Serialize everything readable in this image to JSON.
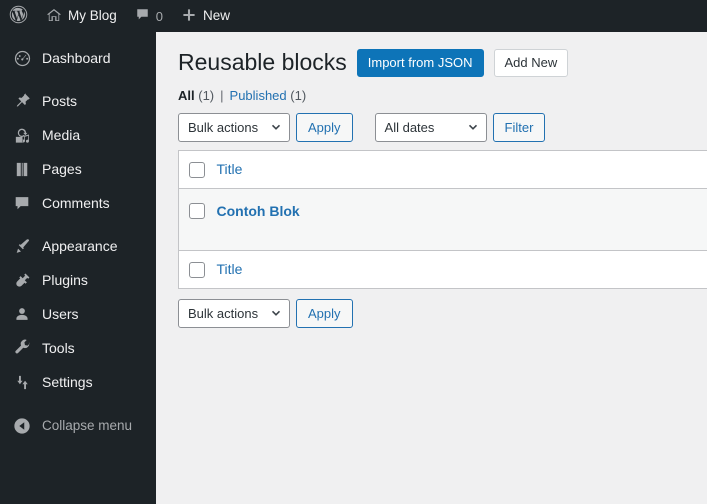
{
  "adminbar": {
    "wp_logo": "wordpress-logo-icon",
    "site": {
      "icon": "home-icon",
      "label": "My Blog"
    },
    "comments": {
      "icon": "comment-bubble-icon",
      "count": "0"
    },
    "new": {
      "icon": "plus-icon",
      "label": "New"
    }
  },
  "sidebar": {
    "items": [
      {
        "label": "Dashboard",
        "icon": "dashboard-icon"
      },
      {
        "label": "Posts",
        "icon": "pin-icon"
      },
      {
        "label": "Media",
        "icon": "media-icon"
      },
      {
        "label": "Pages",
        "icon": "pages-icon"
      },
      {
        "label": "Comments",
        "icon": "comment-bubble-icon"
      },
      {
        "label": "Appearance",
        "icon": "paintbrush-icon"
      },
      {
        "label": "Plugins",
        "icon": "plug-icon"
      },
      {
        "label": "Users",
        "icon": "user-icon"
      },
      {
        "label": "Tools",
        "icon": "wrench-icon"
      },
      {
        "label": "Settings",
        "icon": "sliders-icon"
      }
    ],
    "collapse": {
      "label": "Collapse menu",
      "icon": "collapse-arrow-icon"
    }
  },
  "page": {
    "title": "Reusable blocks",
    "import_button": "Import from JSON",
    "add_new_button": "Add New",
    "filters": {
      "all_label": "All",
      "all_count": "(1)",
      "divider": "|",
      "published_label": "Published",
      "published_count": "(1)"
    },
    "tablenav_top": {
      "bulk_actions": "Bulk actions",
      "apply": "Apply",
      "dates": "All dates",
      "filter": "Filter"
    },
    "tablenav_bottom": {
      "bulk_actions": "Bulk actions",
      "apply": "Apply"
    },
    "table": {
      "columns": [
        "Title"
      ],
      "rows": [
        {
          "title": "Contoh Blok"
        }
      ]
    }
  },
  "colors": {
    "admin_bg": "#1d2327",
    "content_bg": "#f0f0f1",
    "accent_blue": "#2271b1",
    "primary_blue": "#0d74b8",
    "row_alt": "#f6f7f7"
  }
}
